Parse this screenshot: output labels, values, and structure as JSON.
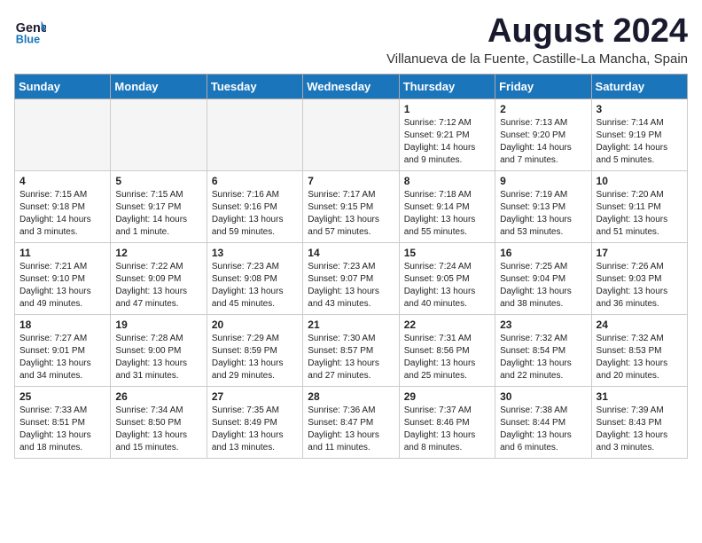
{
  "header": {
    "logo_line1": "General",
    "logo_line2": "Blue",
    "title": "August 2024",
    "subtitle": "Villanueva de la Fuente, Castille-La Mancha, Spain"
  },
  "weekdays": [
    "Sunday",
    "Monday",
    "Tuesday",
    "Wednesday",
    "Thursday",
    "Friday",
    "Saturday"
  ],
  "weeks": [
    [
      {
        "day": "",
        "info": "",
        "empty": true
      },
      {
        "day": "",
        "info": "",
        "empty": true
      },
      {
        "day": "",
        "info": "",
        "empty": true
      },
      {
        "day": "",
        "info": "",
        "empty": true
      },
      {
        "day": "1",
        "info": "Sunrise: 7:12 AM\nSunset: 9:21 PM\nDaylight: 14 hours\nand 9 minutes."
      },
      {
        "day": "2",
        "info": "Sunrise: 7:13 AM\nSunset: 9:20 PM\nDaylight: 14 hours\nand 7 minutes."
      },
      {
        "day": "3",
        "info": "Sunrise: 7:14 AM\nSunset: 9:19 PM\nDaylight: 14 hours\nand 5 minutes."
      }
    ],
    [
      {
        "day": "4",
        "info": "Sunrise: 7:15 AM\nSunset: 9:18 PM\nDaylight: 14 hours\nand 3 minutes."
      },
      {
        "day": "5",
        "info": "Sunrise: 7:15 AM\nSunset: 9:17 PM\nDaylight: 14 hours\nand 1 minute."
      },
      {
        "day": "6",
        "info": "Sunrise: 7:16 AM\nSunset: 9:16 PM\nDaylight: 13 hours\nand 59 minutes."
      },
      {
        "day": "7",
        "info": "Sunrise: 7:17 AM\nSunset: 9:15 PM\nDaylight: 13 hours\nand 57 minutes."
      },
      {
        "day": "8",
        "info": "Sunrise: 7:18 AM\nSunset: 9:14 PM\nDaylight: 13 hours\nand 55 minutes."
      },
      {
        "day": "9",
        "info": "Sunrise: 7:19 AM\nSunset: 9:13 PM\nDaylight: 13 hours\nand 53 minutes."
      },
      {
        "day": "10",
        "info": "Sunrise: 7:20 AM\nSunset: 9:11 PM\nDaylight: 13 hours\nand 51 minutes."
      }
    ],
    [
      {
        "day": "11",
        "info": "Sunrise: 7:21 AM\nSunset: 9:10 PM\nDaylight: 13 hours\nand 49 minutes."
      },
      {
        "day": "12",
        "info": "Sunrise: 7:22 AM\nSunset: 9:09 PM\nDaylight: 13 hours\nand 47 minutes."
      },
      {
        "day": "13",
        "info": "Sunrise: 7:23 AM\nSunset: 9:08 PM\nDaylight: 13 hours\nand 45 minutes."
      },
      {
        "day": "14",
        "info": "Sunrise: 7:23 AM\nSunset: 9:07 PM\nDaylight: 13 hours\nand 43 minutes."
      },
      {
        "day": "15",
        "info": "Sunrise: 7:24 AM\nSunset: 9:05 PM\nDaylight: 13 hours\nand 40 minutes."
      },
      {
        "day": "16",
        "info": "Sunrise: 7:25 AM\nSunset: 9:04 PM\nDaylight: 13 hours\nand 38 minutes."
      },
      {
        "day": "17",
        "info": "Sunrise: 7:26 AM\nSunset: 9:03 PM\nDaylight: 13 hours\nand 36 minutes."
      }
    ],
    [
      {
        "day": "18",
        "info": "Sunrise: 7:27 AM\nSunset: 9:01 PM\nDaylight: 13 hours\nand 34 minutes."
      },
      {
        "day": "19",
        "info": "Sunrise: 7:28 AM\nSunset: 9:00 PM\nDaylight: 13 hours\nand 31 minutes."
      },
      {
        "day": "20",
        "info": "Sunrise: 7:29 AM\nSunset: 8:59 PM\nDaylight: 13 hours\nand 29 minutes."
      },
      {
        "day": "21",
        "info": "Sunrise: 7:30 AM\nSunset: 8:57 PM\nDaylight: 13 hours\nand 27 minutes."
      },
      {
        "day": "22",
        "info": "Sunrise: 7:31 AM\nSunset: 8:56 PM\nDaylight: 13 hours\nand 25 minutes."
      },
      {
        "day": "23",
        "info": "Sunrise: 7:32 AM\nSunset: 8:54 PM\nDaylight: 13 hours\nand 22 minutes."
      },
      {
        "day": "24",
        "info": "Sunrise: 7:32 AM\nSunset: 8:53 PM\nDaylight: 13 hours\nand 20 minutes."
      }
    ],
    [
      {
        "day": "25",
        "info": "Sunrise: 7:33 AM\nSunset: 8:51 PM\nDaylight: 13 hours\nand 18 minutes."
      },
      {
        "day": "26",
        "info": "Sunrise: 7:34 AM\nSunset: 8:50 PM\nDaylight: 13 hours\nand 15 minutes."
      },
      {
        "day": "27",
        "info": "Sunrise: 7:35 AM\nSunset: 8:49 PM\nDaylight: 13 hours\nand 13 minutes."
      },
      {
        "day": "28",
        "info": "Sunrise: 7:36 AM\nSunset: 8:47 PM\nDaylight: 13 hours\nand 11 minutes."
      },
      {
        "day": "29",
        "info": "Sunrise: 7:37 AM\nSunset: 8:46 PM\nDaylight: 13 hours\nand 8 minutes."
      },
      {
        "day": "30",
        "info": "Sunrise: 7:38 AM\nSunset: 8:44 PM\nDaylight: 13 hours\nand 6 minutes."
      },
      {
        "day": "31",
        "info": "Sunrise: 7:39 AM\nSunset: 8:43 PM\nDaylight: 13 hours\nand 3 minutes."
      }
    ]
  ]
}
